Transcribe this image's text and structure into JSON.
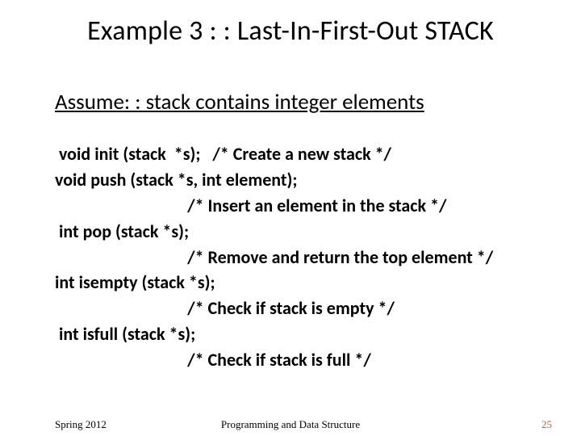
{
  "title": "Example 3 : : Last-In-First-Out STACK",
  "assume": "Assume: : stack contains integer elements",
  "lines": {
    "l1": " void init (stack  *s);   /* Create a new stack */",
    "l2": "",
    "l3": "void push (stack *s, int element);",
    "l4": "                                 /* Insert an element in the stack */",
    "l5": " int pop (stack *s);",
    "l6": "                                 /* Remove and return the top element */",
    "l7": "int isempty (stack *s);",
    "l8": "                                 /* Check if stack is empty */",
    "l9": " int isfull (stack *s);",
    "l10": "                                 /* Check if stack is full */"
  },
  "footer": {
    "left": "Spring 2012",
    "center": "Programming and Data Structure",
    "page": "25"
  }
}
